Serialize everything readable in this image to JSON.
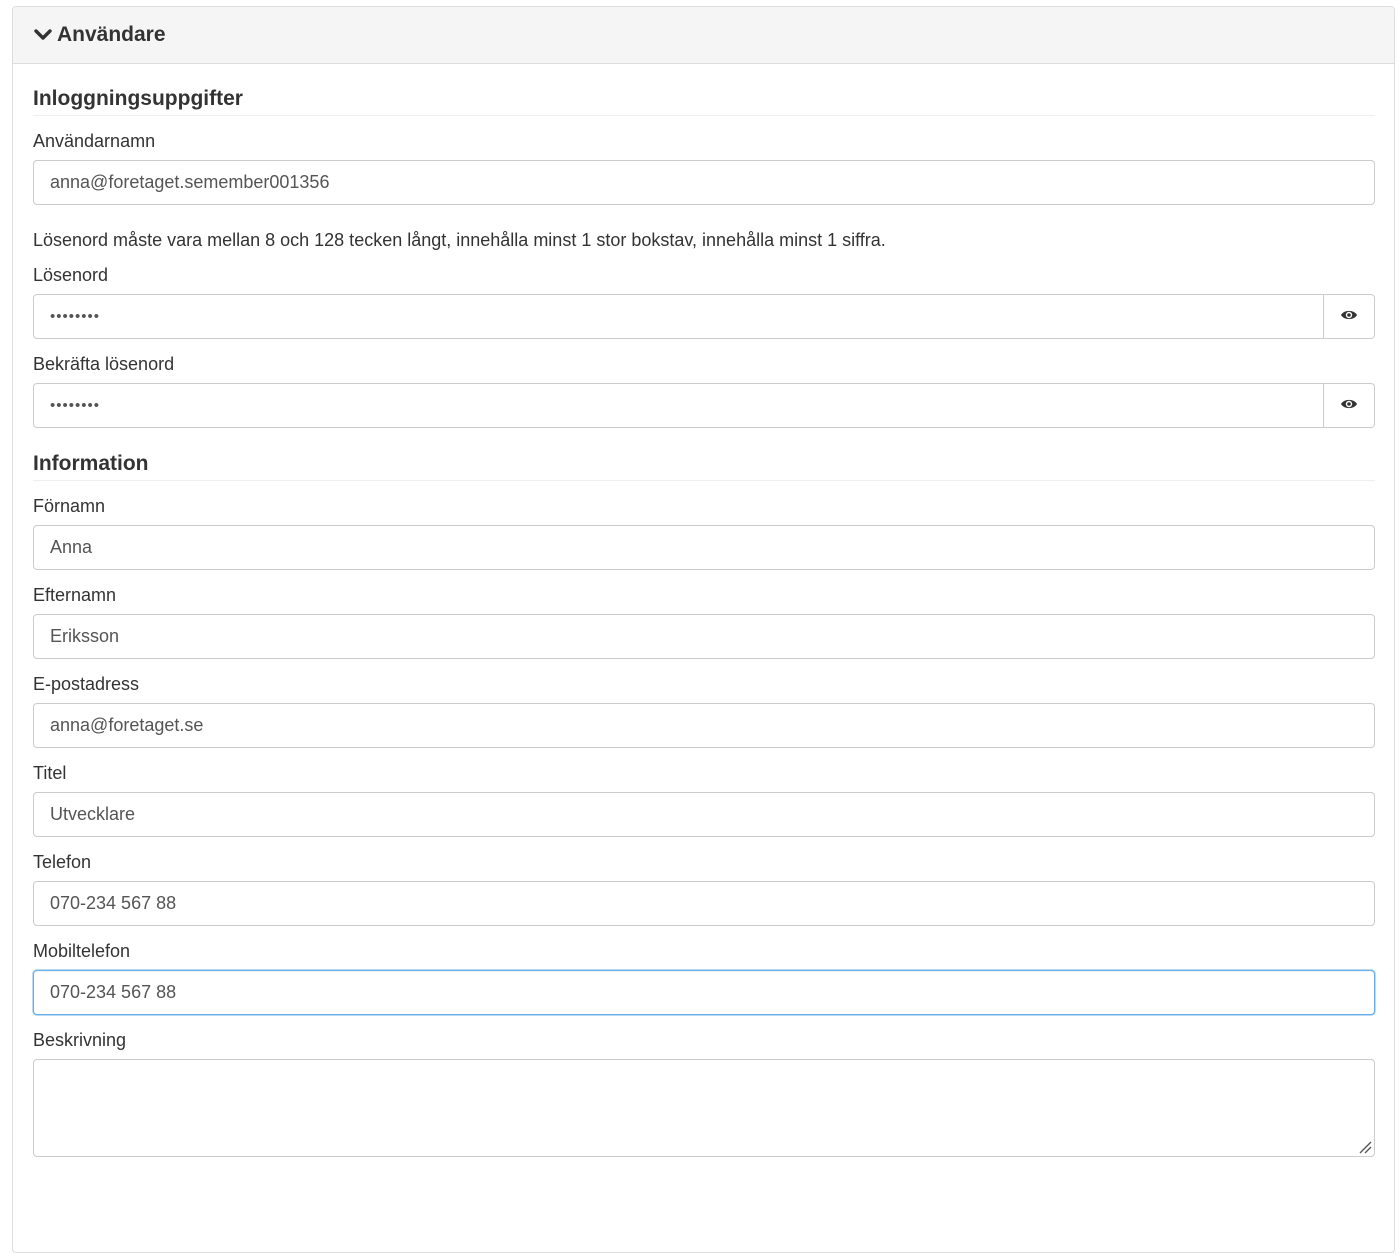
{
  "panel": {
    "title": "Användare"
  },
  "login": {
    "section_title": "Inloggningsuppgifter",
    "username_label": "Användarnamn",
    "username_value": "anna@foretaget.semember001356",
    "password_help": "Lösenord måste vara mellan 8 och 128 tecken långt, innehålla minst 1 stor bokstav, innehålla minst 1 siffra.",
    "password_label": "Lösenord",
    "password_value": "••••••••",
    "confirm_label": "Bekräfta lösenord",
    "confirm_value": "••••••••"
  },
  "info": {
    "section_title": "Information",
    "first_name_label": "Förnamn",
    "first_name_value": "Anna",
    "last_name_label": "Efternamn",
    "last_name_value": "Eriksson",
    "email_label": "E-postadress",
    "email_value": "anna@foretaget.se",
    "title_label": "Titel",
    "title_value": "Utvecklare",
    "phone_label": "Telefon",
    "phone_value": "070-234 567 88",
    "mobile_label": "Mobiltelefon",
    "mobile_value": "070-234 567 88",
    "description_label": "Beskrivning",
    "description_value": ""
  },
  "icons": {
    "collapse": "chevron-down-icon",
    "show_password": "eye-icon"
  },
  "colors": {
    "focus_border": "#66afe9",
    "heading_bg": "#f5f5f5",
    "border": "#cccccc"
  }
}
